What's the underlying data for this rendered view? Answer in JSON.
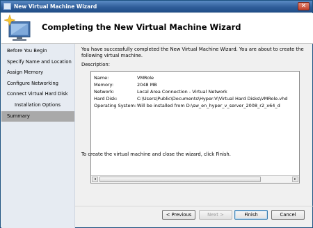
{
  "window": {
    "title": "New Virtual Machine Wizard",
    "close_glyph": "✕"
  },
  "header": {
    "title": "Completing the New Virtual Machine Wizard"
  },
  "sidebar": {
    "items": [
      {
        "label": "Before You Begin"
      },
      {
        "label": "Specify Name and Location"
      },
      {
        "label": "Assign Memory"
      },
      {
        "label": "Configure Networking"
      },
      {
        "label": "Connect Virtual Hard Disk"
      },
      {
        "label": "Installation Options"
      },
      {
        "label": "Summary"
      }
    ]
  },
  "content": {
    "intro": "You have successfully completed the New Virtual Machine Wizard. You are about to create the following virtual machine.",
    "description_label": "Description:",
    "description": [
      {
        "key": "Name:",
        "value": "VMRole"
      },
      {
        "key": "Memory:",
        "value": "2048 MB"
      },
      {
        "key": "Network:",
        "value": "Local Area Connection - Virtual Network"
      },
      {
        "key": "Hard Disk:",
        "value": "C:\\Users\\Public\\Documents\\Hyper-V\\Virtual Hard Disks\\VMRole.vhd"
      },
      {
        "key": "Operating System:",
        "value": "Will be installed from D:\\sw_en_hyper_v_server_2008_r2_x64_d"
      }
    ],
    "footer": "To create the virtual machine and close the wizard, click Finish."
  },
  "buttons": {
    "previous": "< Previous",
    "next": "Next >",
    "finish": "Finish",
    "cancel": "Cancel"
  },
  "scrollbar": {
    "left_glyph": "◂",
    "right_glyph": "▸"
  },
  "colors": {
    "titlebar": "#2f5d99",
    "sidebar_bg": "#e6ebf2",
    "sidebar_active": "#a9a9a9"
  }
}
